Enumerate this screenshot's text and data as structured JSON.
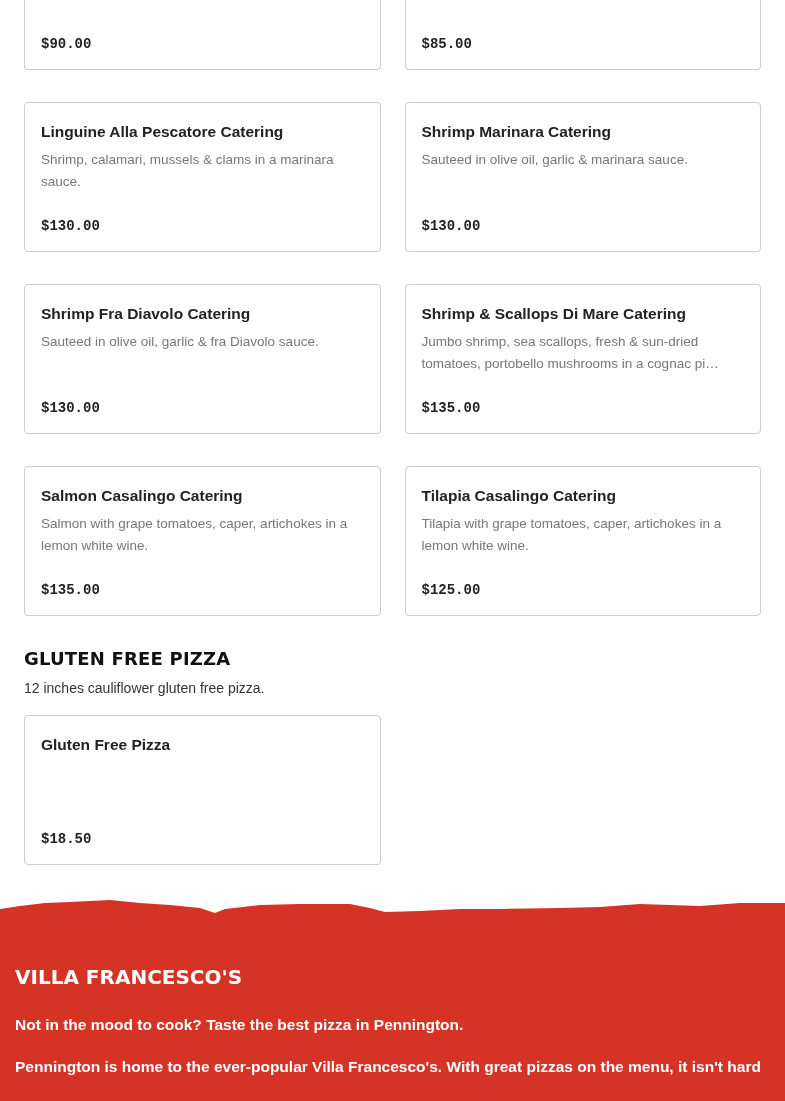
{
  "menu_sections": [
    {
      "items": [
        {
          "price": "$90.00"
        },
        {
          "price": "$85.00"
        },
        {
          "name": "Linguine Alla Pescatore Catering",
          "description": "Shrimp, calamari, mussels & clams in a marinara sauce.",
          "price": "$130.00"
        },
        {
          "name": "Shrimp Marinara Catering",
          "description": "Sauteed in olive oil, garlic & marinara sauce.",
          "price": "$130.00"
        },
        {
          "name": "Shrimp Fra Diavolo Catering",
          "description": "Sauteed in olive oil, garlic & fra Diavolo sauce.",
          "price": "$130.00"
        },
        {
          "name": "Shrimp & Scallops Di Mare Catering",
          "description": "Jumbo shrimp, sea scallops, fresh & sun-dried tomatoes, portobello mushrooms in a cognac pi…",
          "price": "$135.00"
        },
        {
          "name": "Salmon Casalingo Catering",
          "description": "Salmon with grape tomatoes, caper, artichokes in a lemon white wine.",
          "price": "$135.00"
        },
        {
          "name": "Tilapia Casalingo Catering",
          "description": "Tilapia with grape tomatoes, caper, artichokes in a lemon white wine.",
          "price": "$125.00"
        }
      ]
    },
    {
      "title": "GLUTEN FREE PIZZA",
      "description": "12 inches cauliflower gluten free pizza.",
      "items": [
        {
          "name": "Gluten Free Pizza",
          "price": "$18.50"
        }
      ]
    }
  ],
  "footer": {
    "title": "VILLA FRANCESCO'S",
    "paragraphs": [
      "Not in the mood to cook? Taste the best pizza in Pennington.",
      "Pennington is home to the ever-popular Villa Francesco's. With great pizzas on the menu, it isn't hard"
    ]
  }
}
